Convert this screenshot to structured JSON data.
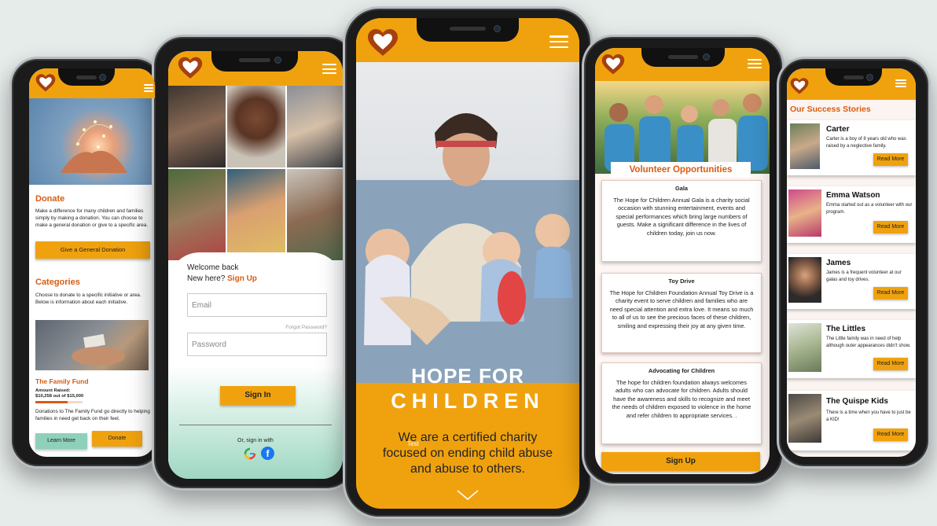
{
  "colors": {
    "brand_orange": "#f0a20e",
    "heading_orange": "#d85c12",
    "teal": "#8fd0bb"
  },
  "phone1": {
    "donate_title": "Donate",
    "donate_text": "Make a difference for many children and families simply by making a donation. You can choose to make a general donation or give to a specific area.",
    "general_donation_button": "Give a General Donation",
    "categories_title": "Categories",
    "categories_text": "Choose to donate to a specific initiative or area. Below is information about each initiative.",
    "fund_title": "The Family Fund",
    "amount_label": "Amount Raised:",
    "amount_value": "$10,258 out of $15,000",
    "fund_progress": 0.68,
    "fund_text": "Donations to The Family Fund go directly to helping families in need get back on their feet.",
    "learn_more_button": "Learn More",
    "donate_button": "Donate"
  },
  "phone2": {
    "welcome": "Welcome back",
    "new_here": "New here?",
    "sign_up_link": "Sign Up",
    "email_placeholder": "Email",
    "forgot_password": "Forgot Password?",
    "password_placeholder": "Password",
    "sign_in_button": "Sign In",
    "or_sign_in_with": "Or, sign in with"
  },
  "phone3": {
    "hero_line1": "HOPE FOR",
    "hero_line2": "CHILDREN",
    "tagline": "We are a certified charity focused on ending child abuse and abuse to others.",
    "overlay_text": "Test"
  },
  "phone4": {
    "banner": "Volunteer Opportunities",
    "cards": [
      {
        "title": "Gala",
        "text": "The Hope for Children Annual Gala is a charity social occasion with stunning entertainment, events and special performances which bring large numbers of guests. Make a significant difference in the lives of children today, join us now."
      },
      {
        "title": "Toy Drive",
        "text": "The Hope for Children Foundation Annual Toy Drive is a charity event to serve children and families who are need special attention and extra love. It means so much to all of us to see the precious faces of these children, smiling and expressing their joy at any given time."
      },
      {
        "title": "Advocating for Children",
        "text": "The hope for children foundation always welcomes adults who can advocate for children. Adults should have the awareness and skills to recognize and meet the needs of children exposed to violence in the home and refer children to appropriate services.  ."
      }
    ],
    "sign_up_button": "Sign Up"
  },
  "phone5": {
    "title": "Our Success Stories",
    "read_more": "Read More",
    "stories": [
      {
        "name": "Carter",
        "text": "Carter is a boy of 8 years old  who was raised by a neglective family."
      },
      {
        "name": "Emma Watson",
        "text": "Emma started out as a volunteer with our program."
      },
      {
        "name": "James",
        "text": "James is a frequent volunteer at our galas and toy drives."
      },
      {
        "name": "The Littles",
        "text": "The Little family was in need of help although outer appearances didn't show."
      },
      {
        "name": "The Quispe Kids",
        "text": "There is a time when you have to just be a KID!"
      }
    ]
  }
}
